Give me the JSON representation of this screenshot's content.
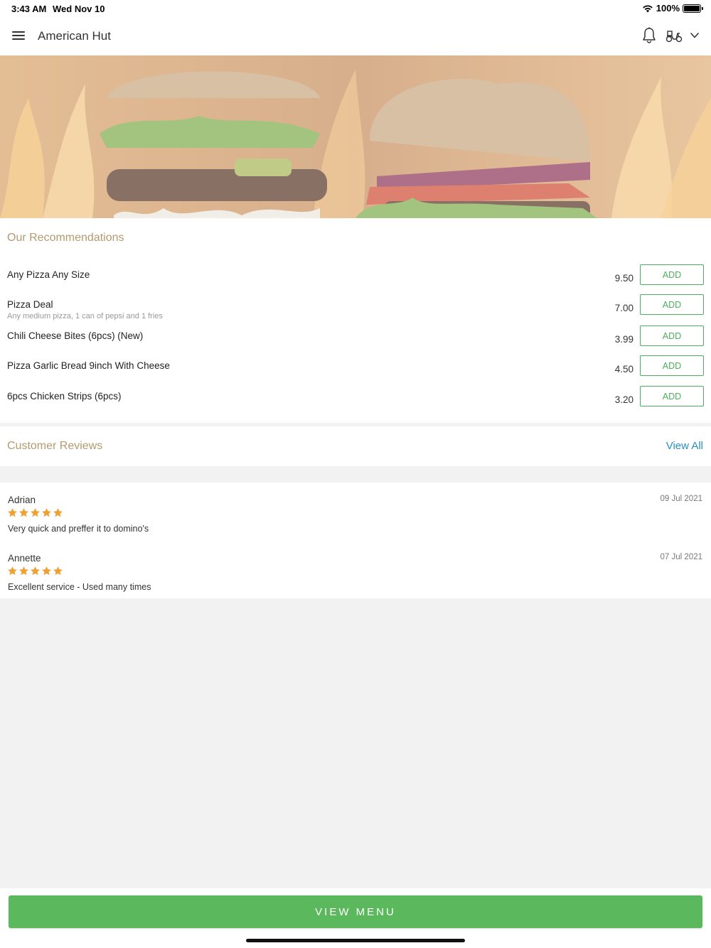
{
  "status_bar": {
    "time": "3:43 AM",
    "date": "Wed Nov 10",
    "battery": "100%"
  },
  "header": {
    "title": "American Hut",
    "icons": [
      "menu-icon",
      "bell-icon",
      "scooter-icon",
      "chevron-down-icon"
    ]
  },
  "recommendations": {
    "title": "Our Recommendations",
    "add_label": "ADD",
    "items": [
      {
        "name": "Any Pizza Any Size",
        "desc": "",
        "price": "9.50"
      },
      {
        "name": "Pizza Deal",
        "desc": "Any medium pizza, 1 can of pepsi and 1 fries",
        "price": "7.00"
      },
      {
        "name": "Chili Cheese Bites (6pcs) (New)",
        "desc": "",
        "price": "3.99"
      },
      {
        "name": "Pizza Garlic Bread 9inch With Cheese",
        "desc": "",
        "price": "4.50"
      },
      {
        "name": "6pcs Chicken Strips (6pcs)",
        "desc": "",
        "price": "3.20"
      }
    ]
  },
  "reviews": {
    "title": "Customer Reviews",
    "view_all": "View All",
    "items": [
      {
        "name": "Adrian",
        "date": "09 Jul 2021",
        "rating": 5,
        "text": "Very quick and preffer it to domino's"
      },
      {
        "name": "Annette",
        "date": "07 Jul 2021",
        "rating": 5,
        "text": "Excellent service - Used many times"
      }
    ]
  },
  "footer": {
    "view_menu": "VIEW MENU"
  },
  "colors": {
    "accent_green": "#5cb85c",
    "section_title": "#b49a6e",
    "link_blue": "#2a8fbd",
    "star_orange": "#f0a030"
  }
}
